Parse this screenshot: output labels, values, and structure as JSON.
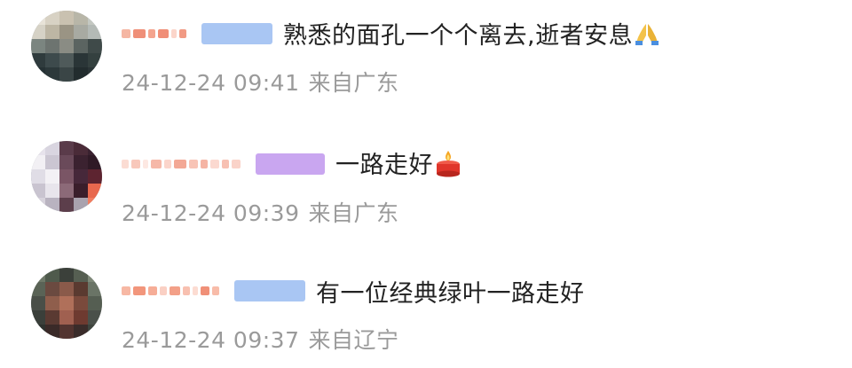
{
  "comments": [
    {
      "username_color": "#f2a08a",
      "badge_color": "#a9c6f3",
      "text": "熟悉的面孔一个个离去,逝者安息",
      "emoji": "pray-emoji",
      "time": "24-12-24 09:41",
      "source": "来自广东"
    },
    {
      "username_color": "#f7c2b6",
      "badge_color": "#c9a6f0",
      "text": "一路走好",
      "emoji": "candle-emoji",
      "time": "24-12-24 09:39",
      "source": "来自广东"
    },
    {
      "username_color": "#f3a488",
      "badge_color": "#a9c6f3",
      "text": "有一位经典绿叶一路走好",
      "emoji": "",
      "time": "24-12-24 09:37",
      "source": "来自辽宁"
    }
  ]
}
